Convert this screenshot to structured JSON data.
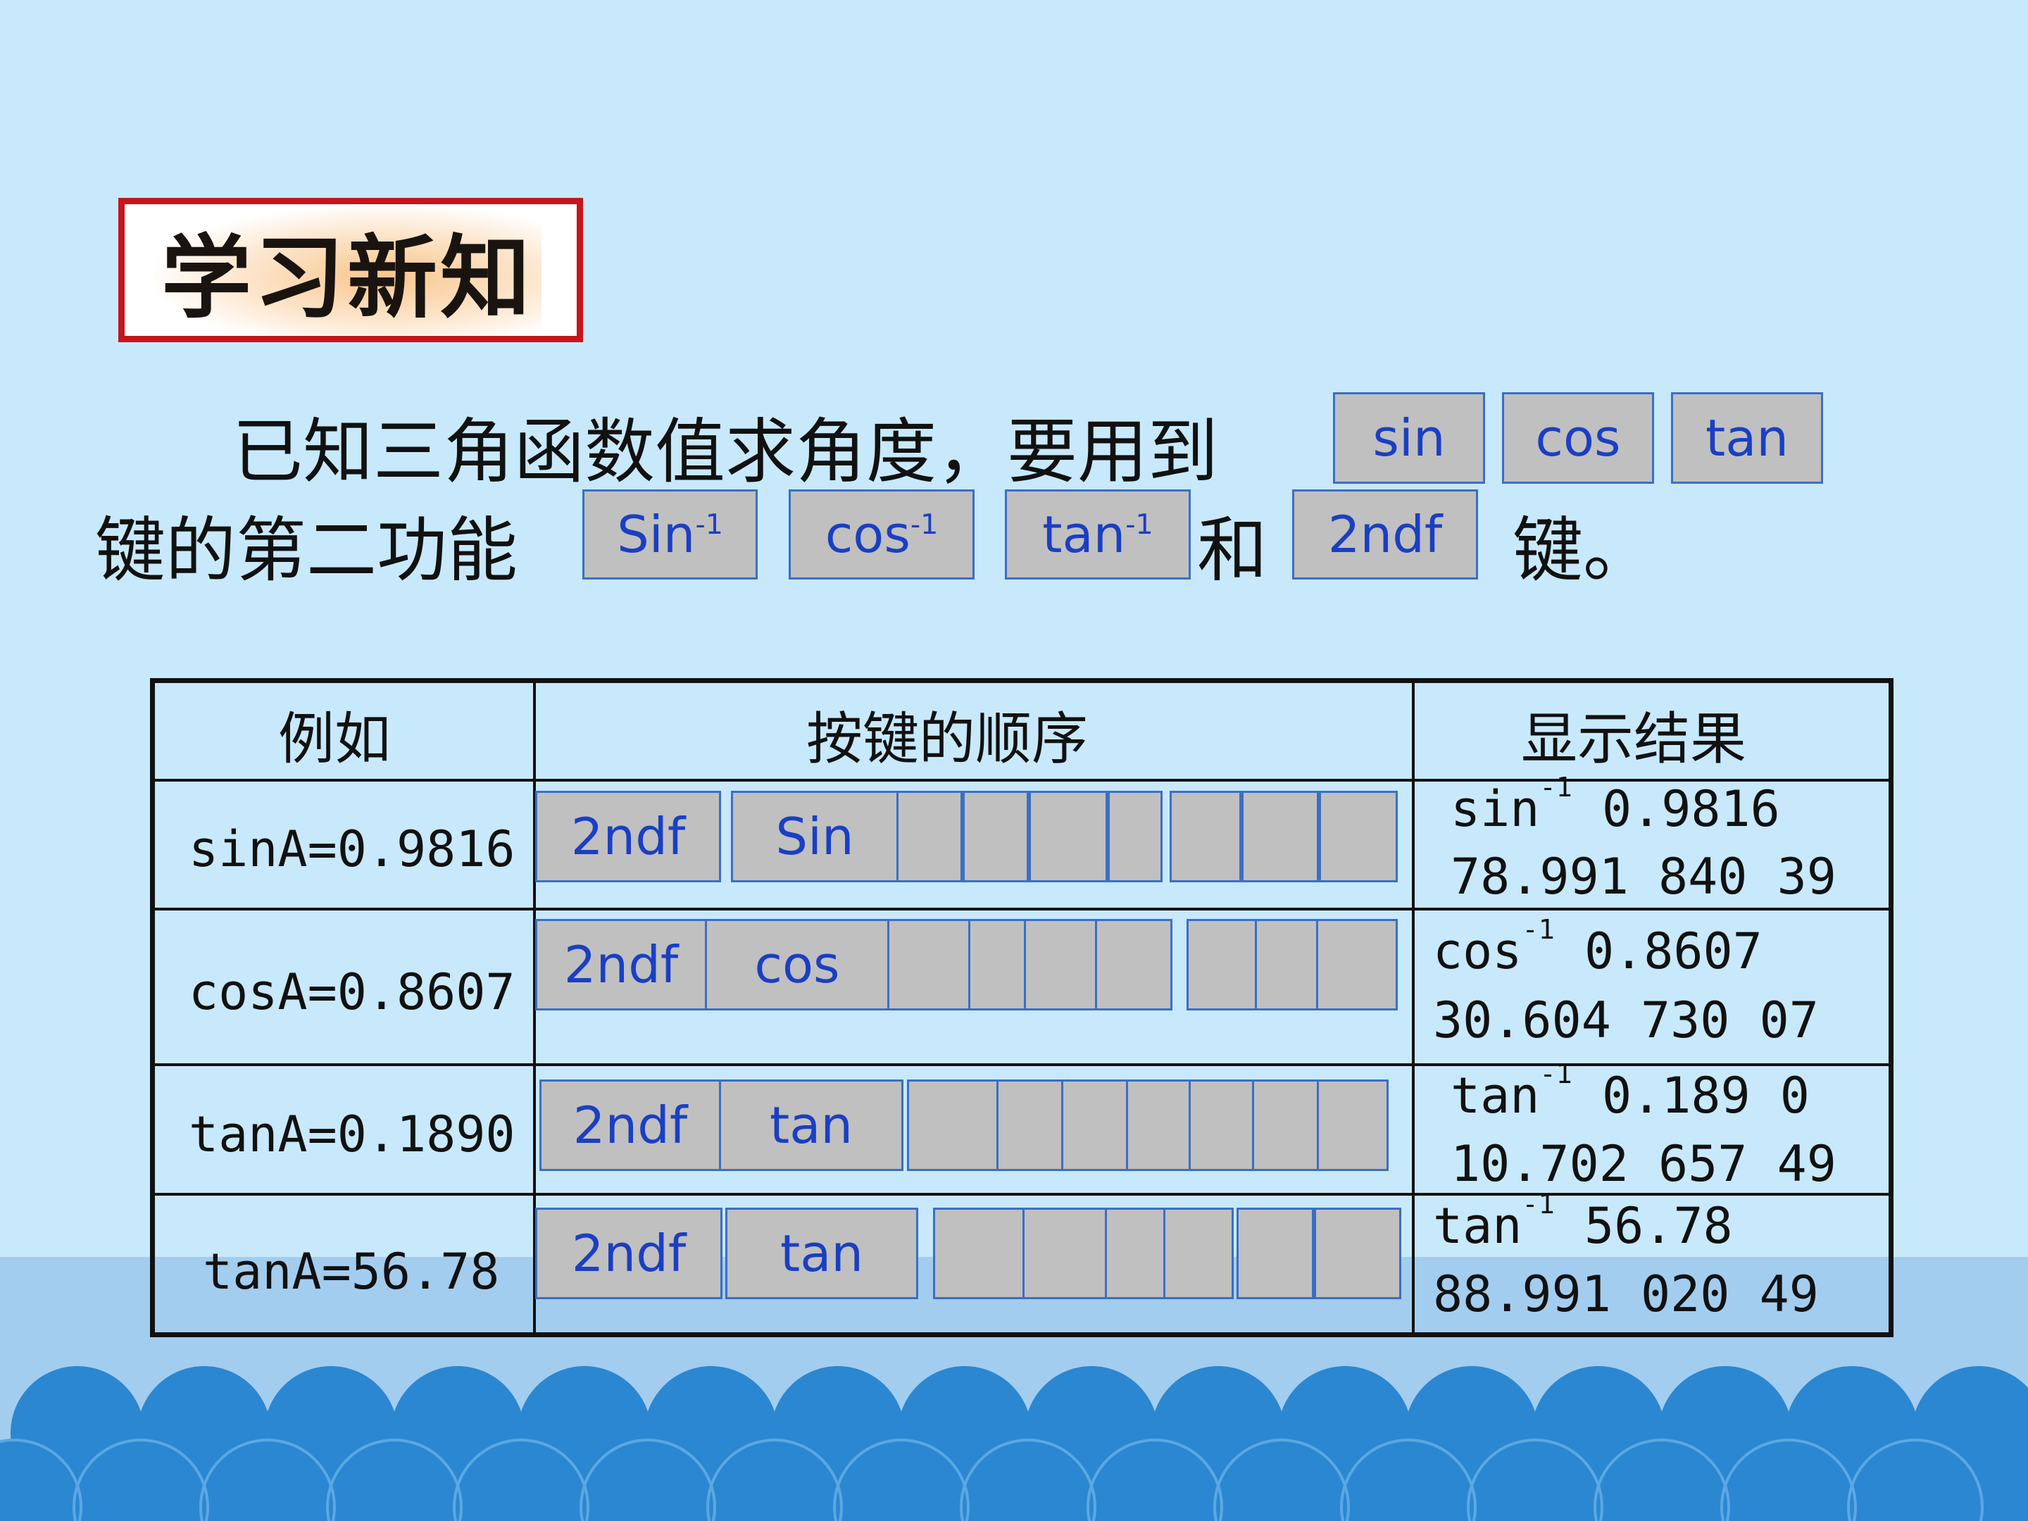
{
  "title": "学习新知",
  "intro": {
    "line1": "已知三角函数值求角度，要用到",
    "line2_a": "键的第二功能",
    "line2_he": "和",
    "line2_end": "键。",
    "keys_top": [
      "sin",
      "cos",
      "tan"
    ],
    "keys_inverse": [
      {
        "base": "Sin",
        "sup": "-1"
      },
      {
        "base": "cos",
        "sup": "-1"
      },
      {
        "base": "tan",
        "sup": "-1"
      }
    ],
    "key_2ndf": "2ndf"
  },
  "table": {
    "headers": [
      "例如",
      "按键的顺序",
      "显示结果"
    ],
    "rows": [
      {
        "example": "sinA=0.9816",
        "key1": "2ndf",
        "key2": "Sin",
        "result_fn": "sin",
        "result_sup": "-1",
        "result_arg": " 0.9816",
        "result_value": "78.991 840 39"
      },
      {
        "example": "cosA=0.8607",
        "key1": "2ndf",
        "key2": "cos",
        "result_fn": "cos",
        "result_sup": "-1",
        "result_arg": " 0.8607",
        "result_value": "30.604 730 07"
      },
      {
        "example": "tanA=0.1890",
        "key1": "2ndf",
        "key2": "tan",
        "result_fn": "tan",
        "result_sup": "-1",
        "result_arg": " 0.189 0",
        "result_value": "10.702 657 49"
      },
      {
        "example": "tanA=56.78",
        "key1": "2ndf",
        "key2": "tan",
        "result_fn": "tan",
        "result_sup": "-1",
        "result_arg": " 56.78",
        "result_value": "88.991 020 49"
      }
    ]
  },
  "colors": {
    "background": "#c8e9fb",
    "key_fill": "#c0c0c0",
    "key_border": "#3b6fc4",
    "key_text": "#1a3fc4",
    "title_border": "#c8141c",
    "wave": "#2b87d1"
  }
}
